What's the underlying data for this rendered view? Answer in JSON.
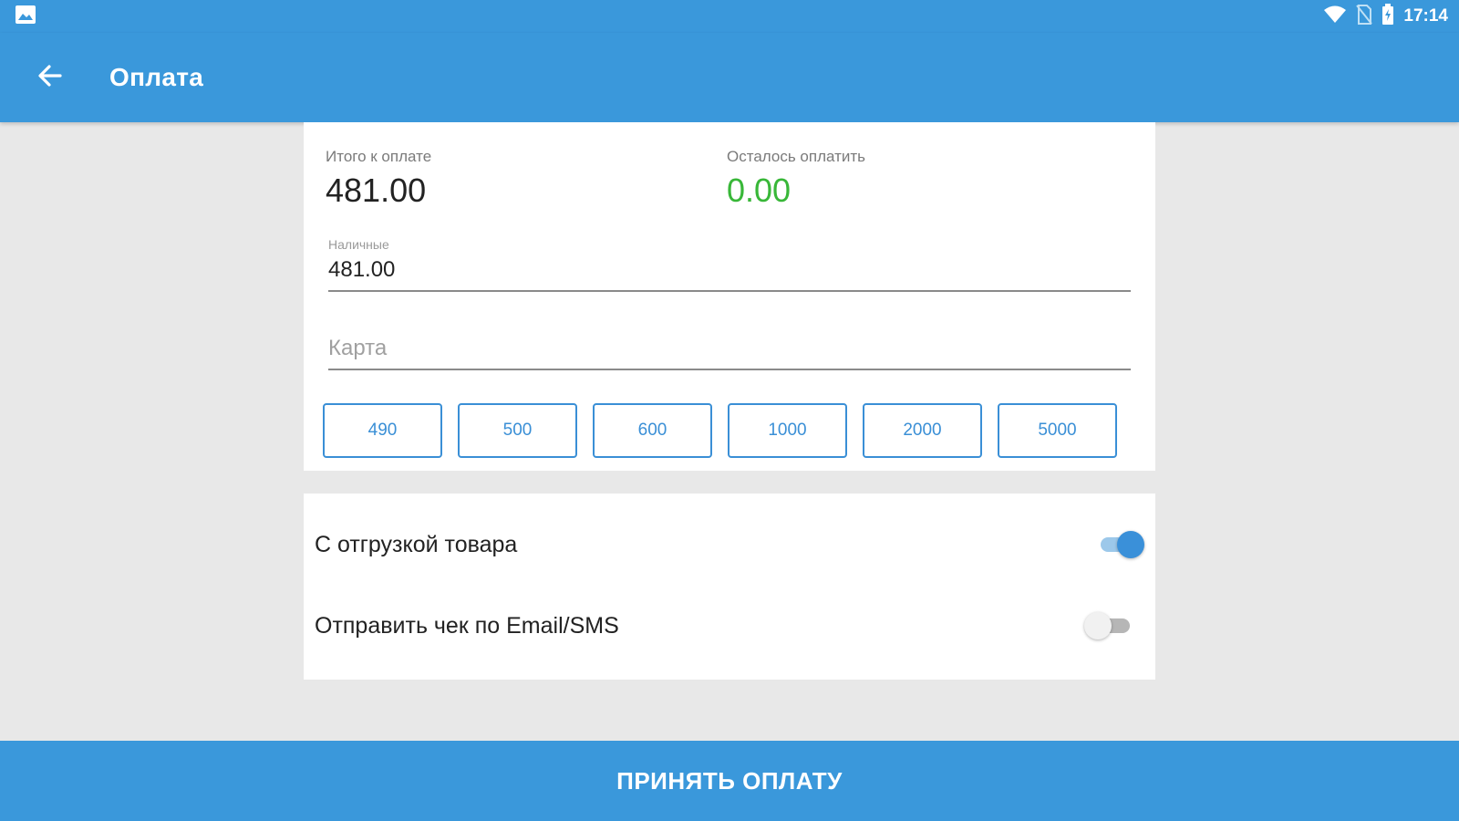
{
  "status_bar": {
    "time": "17:14",
    "icons": [
      "image-notification-icon",
      "wifi-icon",
      "no-sim-icon",
      "battery-icon"
    ]
  },
  "app_bar": {
    "title": "Оплата",
    "back_icon": "arrow-back-icon"
  },
  "payment": {
    "total_label": "Итого к оплате",
    "total_value": "481.00",
    "remaining_label": "Осталось оплатить",
    "remaining_value": "0.00",
    "remaining_color": "#38b738",
    "cash_label": "Наличные",
    "cash_value": "481.00",
    "card_placeholder": "Карта",
    "quick_amounts": [
      "490",
      "500",
      "600",
      "1000",
      "2000",
      "5000"
    ]
  },
  "options": {
    "shipment_label": "С отгрузкой товара",
    "shipment_on": true,
    "send_receipt_label": "Отправить чек по Email/SMS",
    "send_receipt_on": false
  },
  "action": {
    "accept_label": "ПРИНЯТЬ ОПЛАТУ"
  },
  "colors": {
    "primary": "#3a98db",
    "accent": "#3a90d9",
    "positive": "#38b738"
  }
}
